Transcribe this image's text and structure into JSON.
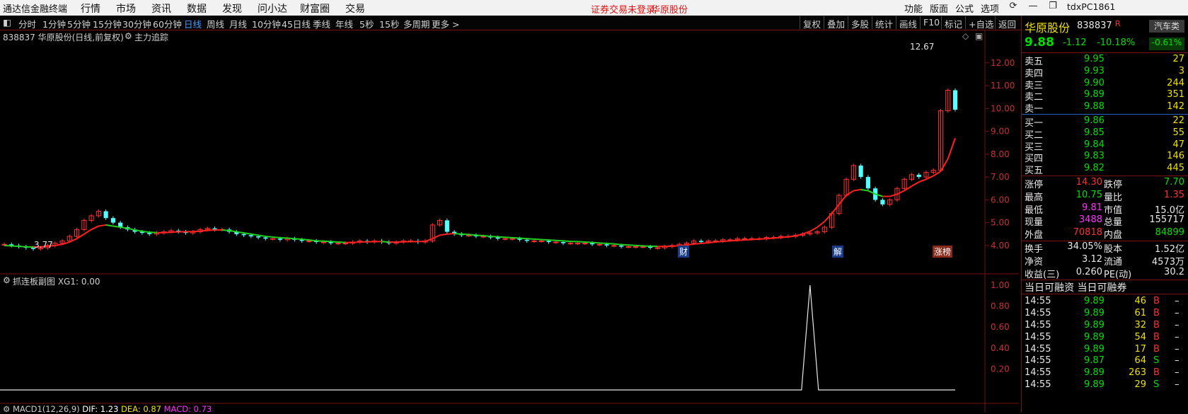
{
  "menu": {
    "app_name": "通达信金融终端",
    "items": [
      "行情",
      "市场",
      "资讯",
      "数据",
      "发现",
      "问小达",
      "财富圈",
      "交易"
    ],
    "notice": "证券交易未登录",
    "stock_link": "华原股份",
    "right_items": [
      "功能",
      "版面",
      "公式",
      "选项"
    ],
    "user": "tdxPC1861"
  },
  "toolbar": {
    "periods": [
      "分时",
      "1分钟",
      "5分钟",
      "15分钟",
      "30分钟",
      "60分钟",
      "日线",
      "周线",
      "月线",
      "10分钟",
      "45日线",
      "季线",
      "年线",
      "5秒",
      "15秒",
      "多周期",
      "更多 >"
    ],
    "active": "日线",
    "right_buttons": [
      "复权",
      "叠加",
      "多股",
      "统计",
      "画线",
      "F10",
      "标记",
      "+自选",
      "返回"
    ]
  },
  "chart": {
    "header": "838837 华原股份(日线,前复权)",
    "indicator_name": "主力追踪",
    "high_label": "12.67",
    "low_label": "3.77",
    "price_axis": [
      "12.00",
      "11.00",
      "10.00",
      "9.00",
      "8.00",
      "7.00",
      "6.00",
      "5.00",
      "4.00"
    ],
    "event_markers": [
      "财",
      "解",
      "涨榜"
    ],
    "sub_header": "抓连板副图  XG1: 0.00",
    "sub_axis": [
      "1.00",
      "0.80",
      "0.60",
      "0.40",
      "0.20"
    ],
    "macd_label": "MACD1(12,26,9)",
    "dif": "DIF: 1.23",
    "dea": "DEA: 0.87",
    "macd": "MACD: 0.73"
  },
  "chart_data": {
    "type": "candlestick",
    "ylim": [
      3.5,
      12.8
    ],
    "sub_ylim": [
      0,
      1.0
    ],
    "closes": [
      4.05,
      4.0,
      3.95,
      3.9,
      3.85,
      3.9,
      4.0,
      4.1,
      4.2,
      4.4,
      4.7,
      5.1,
      5.3,
      5.5,
      5.2,
      5.0,
      4.8,
      4.7,
      4.6,
      4.55,
      4.5,
      4.55,
      4.6,
      4.65,
      4.6,
      4.55,
      4.6,
      4.7,
      4.75,
      4.7,
      4.7,
      4.6,
      4.5,
      4.45,
      4.4,
      4.35,
      4.3,
      4.3,
      4.25,
      4.3,
      4.25,
      4.2,
      4.2,
      4.15,
      4.15,
      4.1,
      4.1,
      4.1,
      4.15,
      4.2,
      4.15,
      4.2,
      4.15,
      4.1,
      4.15,
      4.2,
      4.2,
      4.15,
      4.2,
      4.9,
      5.1,
      4.6,
      4.5,
      4.45,
      4.45,
      4.4,
      4.4,
      4.35,
      4.3,
      4.3,
      4.3,
      4.25,
      4.2,
      4.2,
      4.2,
      4.15,
      4.15,
      4.1,
      4.1,
      4.1,
      4.1,
      4.05,
      4.05,
      4.0,
      4.0,
      3.95,
      3.95,
      3.95,
      3.95,
      3.9,
      3.9,
      3.95,
      4.0,
      4.05,
      4.1,
      4.2,
      4.15,
      4.2,
      4.2,
      4.25,
      4.25,
      4.3,
      4.3,
      4.3,
      4.3,
      4.35,
      4.35,
      4.4,
      4.4,
      4.45,
      4.5,
      4.55,
      4.6,
      4.8,
      5.4,
      6.2,
      6.9,
      7.5,
      7.0,
      6.5,
      6.0,
      5.8,
      6.0,
      6.5,
      6.9,
      7.1,
      7.0,
      7.2,
      7.3,
      9.9,
      10.8,
      9.95
    ],
    "ma": [
      4.0,
      3.98,
      3.96,
      3.94,
      3.93,
      3.94,
      3.97,
      4.0,
      4.05,
      4.15,
      4.3,
      4.5,
      4.7,
      4.85,
      4.9,
      4.85,
      4.8,
      4.75,
      4.68,
      4.62,
      4.58,
      4.56,
      4.56,
      4.58,
      4.6,
      4.6,
      4.61,
      4.63,
      4.66,
      4.68,
      4.68,
      4.65,
      4.6,
      4.55,
      4.5,
      4.45,
      4.4,
      4.37,
      4.34,
      4.32,
      4.3,
      4.27,
      4.24,
      4.2,
      4.19,
      4.17,
      4.15,
      4.13,
      4.13,
      4.15,
      4.16,
      4.17,
      4.17,
      4.15,
      4.15,
      4.16,
      4.17,
      4.17,
      4.18,
      4.3,
      4.45,
      4.5,
      4.52,
      4.5,
      4.48,
      4.45,
      4.43,
      4.4,
      4.38,
      4.36,
      4.34,
      4.32,
      4.3,
      4.28,
      4.26,
      4.24,
      4.22,
      4.2,
      4.18,
      4.17,
      4.15,
      4.13,
      4.11,
      4.09,
      4.07,
      4.04,
      4.02,
      4.0,
      3.98,
      3.97,
      3.96,
      3.96,
      3.97,
      3.99,
      4.02,
      4.06,
      4.09,
      4.12,
      4.15,
      4.18,
      4.2,
      4.22,
      4.24,
      4.26,
      4.28,
      4.3,
      4.32,
      4.35,
      4.38,
      4.42,
      4.5,
      4.62,
      4.8,
      5.05,
      5.4,
      5.8,
      6.2,
      6.4,
      6.45,
      6.4,
      6.25,
      6.15,
      6.15,
      6.25,
      6.4,
      6.6,
      6.78,
      6.9,
      7.05,
      7.25,
      7.8,
      8.7
    ],
    "sub_spike_index": 111
  },
  "quote": {
    "name": "华原股份",
    "code": "838837",
    "flag": "R",
    "sector": "汽车类",
    "price": "9.88",
    "change": "-1.12",
    "pct": "-10.18%",
    "sector_pct": "-0.61%",
    "asks": [
      [
        "卖五",
        "9.95",
        "27"
      ],
      [
        "卖四",
        "9.93",
        "3"
      ],
      [
        "卖三",
        "9.90",
        "244"
      ],
      [
        "卖二",
        "9.89",
        "351"
      ],
      [
        "卖一",
        "9.88",
        "142"
      ]
    ],
    "bids": [
      [
        "买一",
        "9.86",
        "22"
      ],
      [
        "买二",
        "9.85",
        "55"
      ],
      [
        "买三",
        "9.84",
        "47"
      ],
      [
        "买四",
        "9.83",
        "146"
      ],
      [
        "买五",
        "9.82",
        "445"
      ]
    ],
    "stats": [
      [
        "涨停",
        "14.30",
        "跌停",
        "7.70"
      ],
      [
        "最高",
        "10.75",
        "量比",
        "1.35"
      ],
      [
        "最低",
        "9.81",
        "市值",
        "15.0亿"
      ],
      [
        "现量",
        "3488",
        "总量",
        "155717"
      ],
      [
        "外盘",
        "70818",
        "内盘",
        "84899"
      ]
    ],
    "stats2": [
      [
        "换手",
        "34.05%",
        "股本",
        "1.52亿"
      ],
      [
        "净资",
        "3.12",
        "流通",
        "4573万"
      ],
      [
        "收益(三)",
        "0.260",
        "PE(动)",
        "30.2"
      ]
    ],
    "margin_label": "当日可融资 当日可融券",
    "ticks": [
      [
        "14:55",
        "9.89",
        "46",
        "B"
      ],
      [
        "14:55",
        "9.89",
        "61",
        "B"
      ],
      [
        "14:55",
        "9.89",
        "32",
        "B"
      ],
      [
        "14:55",
        "9.89",
        "54",
        "B"
      ],
      [
        "14:55",
        "9.89",
        "17",
        "B"
      ],
      [
        "14:55",
        "9.87",
        "64",
        "S"
      ],
      [
        "14:55",
        "9.89",
        "263",
        "B"
      ],
      [
        "14:55",
        "9.89",
        "29",
        "S"
      ]
    ]
  }
}
